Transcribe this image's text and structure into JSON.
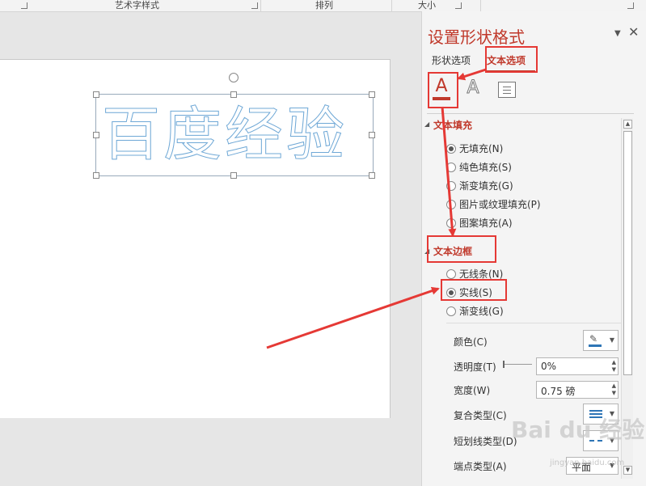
{
  "ribbon": {
    "groups": [
      "艺术字样式",
      "排列",
      "大小"
    ]
  },
  "slide": {
    "wordart_text": "百度经验"
  },
  "pane": {
    "title": "设置形状格式",
    "tabs": [
      "形状选项",
      "文本选项"
    ],
    "active_tab": "文本选项",
    "icons": [
      "text-fill-outline-icon",
      "text-effects-icon",
      "textbox-icon"
    ],
    "fill_section": {
      "title": "文本填充",
      "options": [
        "无填充(N)",
        "纯色填充(S)",
        "渐变填充(G)",
        "图片或纹理填充(P)",
        "图案填充(A)"
      ]
    },
    "border_section": {
      "title": "文本边框",
      "options": [
        "无线条(N)",
        "实线(S)",
        "渐变线(G)"
      ],
      "selected": "实线(S)"
    },
    "props": {
      "color_label": "颜色(C)",
      "transparency_label": "透明度(T)",
      "transparency_value": "0%",
      "width_label": "宽度(W)",
      "width_value": "0.75 磅",
      "compound_label": "复合类型(C)",
      "dash_label": "短划线类型(D)",
      "cap_label": "端点类型(A)",
      "cap_value": "平面"
    }
  },
  "watermark": {
    "brand": "Bai du 经验",
    "url": "jingyan.baidu.com"
  },
  "colors": {
    "accent": "#c0392b",
    "annotation": "#e53935",
    "wordart_outline": "#6fa8d6"
  }
}
